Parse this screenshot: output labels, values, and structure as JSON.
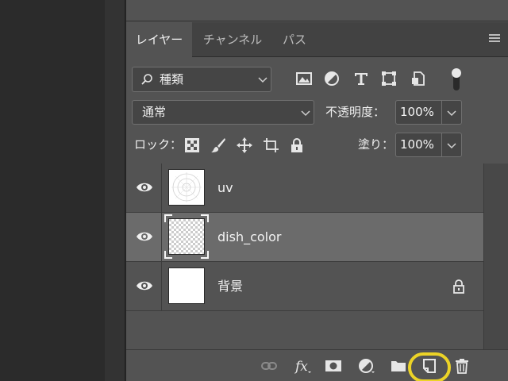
{
  "tabs": [
    {
      "label": "レイヤー",
      "active": true
    },
    {
      "label": "チャンネル",
      "active": false
    },
    {
      "label": "パス",
      "active": false
    }
  ],
  "filter": {
    "kind_label": "種類"
  },
  "blend": {
    "mode_label": "通常"
  },
  "opacity": {
    "label": "不透明度：",
    "value": "100%"
  },
  "fill": {
    "label": "塗り：",
    "value": "100%"
  },
  "lock": {
    "label": "ロック："
  },
  "layers": [
    {
      "name": "uv",
      "visible": true,
      "selected": false,
      "locked": false,
      "thumbnail": "uv-grid"
    },
    {
      "name": "dish_color",
      "visible": true,
      "selected": true,
      "locked": false,
      "thumbnail": "transparent"
    },
    {
      "name": "背景",
      "visible": true,
      "selected": false,
      "locked": true,
      "thumbnail": "white"
    }
  ],
  "bottom_icons": [
    "link-icon",
    "fx-icon",
    "mask-icon",
    "adjustment-icon",
    "folder-icon",
    "new-layer-icon",
    "trash-icon"
  ],
  "colors": {
    "highlight": "#ecd327",
    "panel": "#535353",
    "selected_row": "#6b6b6b"
  }
}
